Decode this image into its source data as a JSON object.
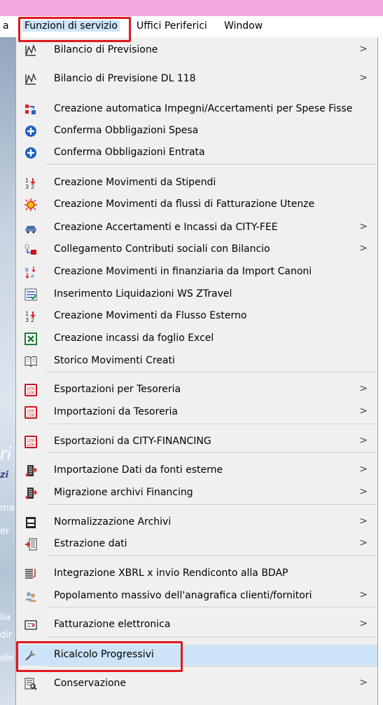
{
  "menubar": {
    "partial_left": "a",
    "funzioni": "Funzioni di servizio",
    "uffici": "Uffici Periferici",
    "window": "Window"
  },
  "background_text": {
    "ri": "ri",
    "zi": "zi",
    "ma": "ma",
    "er": "er",
    "lia": "lia",
    "dir": "dir",
    "ele": "ele"
  },
  "colors": {
    "highlight": "#cce4f7",
    "annotation_red": "#e0181f",
    "menu_bg": "#f0f0f0",
    "title_pink": "#f2a9de"
  },
  "menu": {
    "items": [
      {
        "label": "Bilancio di Previsione",
        "icon": "chart-icon",
        "submenu": true
      },
      {
        "label": "Bilancio di Previsione DL 118",
        "icon": "chart-icon",
        "submenu": true
      },
      {
        "label": "Creazione automatica Impegni/Accertamenti per Spese Fisse",
        "icon": "grid-arrow-icon",
        "submenu": false
      },
      {
        "label": "Conferma Obbligazioni Spesa",
        "icon": "plus-circle-icon",
        "submenu": false
      },
      {
        "label": "Conferma Obbligazioni Entrata",
        "icon": "plus-circle-icon",
        "submenu": false
      },
      {
        "label": "Creazione Movimenti da Stipendi",
        "icon": "sort-numbers-icon",
        "submenu": false
      },
      {
        "label": "Creazione Movimenti da flussi di Fatturazione Utenze",
        "icon": "lightbulb-icon",
        "submenu": false
      },
      {
        "label": "Creazione Accertamenti e Incassi da CITY-FEE",
        "icon": "car-icon",
        "submenu": true
      },
      {
        "label": "Collegamento Contributi sociali con Bilancio",
        "icon": "link-icon",
        "submenu": true
      },
      {
        "label": "Creazione Movimenti in finanziaria da Import Canoni",
        "icon": "sort-az-icon",
        "submenu": false
      },
      {
        "label": "Inserimento Liquidazioni WS ZTravel",
        "icon": "list-check-icon",
        "submenu": false
      },
      {
        "label": "Creazione Movimenti da Flusso Esterno",
        "icon": "sort-numbers-icon",
        "submenu": false
      },
      {
        "label": "Creazione incassi da foglio Excel",
        "icon": "excel-icon",
        "submenu": false
      },
      {
        "label": "Storico Movimenti Creati",
        "icon": "book-icon",
        "submenu": false
      },
      {
        "label": "Esportazioni per Tesoreria",
        "icon": "numbers-box-icon",
        "submenu": true
      },
      {
        "label": "Importazioni da Tesoreria",
        "icon": "numbers-box-icon",
        "submenu": true
      },
      {
        "label": "Esportazioni da CITY-FINANCING",
        "icon": "numbers-box-icon",
        "submenu": true
      },
      {
        "label": "Importazione Dati da fonti esterne",
        "icon": "import-list-icon",
        "submenu": true
      },
      {
        "label": "Migrazione archivi Financing",
        "icon": "import-list-icon",
        "submenu": true
      },
      {
        "label": "Normalizzazione Archivi",
        "icon": "database-icon",
        "submenu": true
      },
      {
        "label": "Estrazione dati",
        "icon": "extract-icon",
        "submenu": true
      },
      {
        "label": "Integrazione XBRL x invio Rendiconto alla BDAP",
        "icon": "document-lines-icon",
        "submenu": false
      },
      {
        "label": "Popolamento massivo dell'anagrafica clienti/fornitori",
        "icon": "users-icon",
        "submenu": true
      },
      {
        "label": "Fatturazione elettronica",
        "icon": "invoice-icon",
        "submenu": true
      },
      {
        "label": "Ricalcolo Progressivi",
        "icon": "wrench-icon",
        "submenu": false
      },
      {
        "label": "Conservazione",
        "icon": "archive-search-icon",
        "submenu": true
      }
    ],
    "submenu_arrow": ">"
  }
}
